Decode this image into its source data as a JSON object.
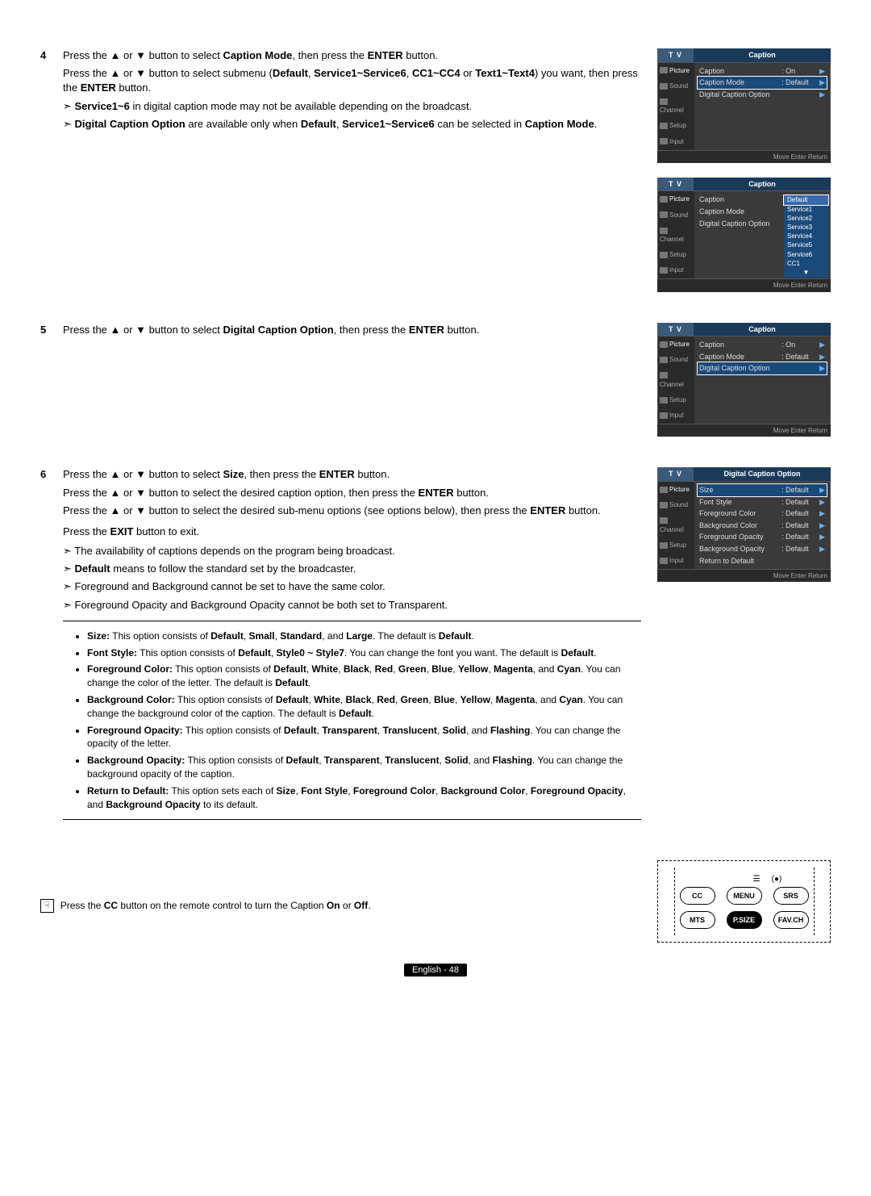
{
  "steps": {
    "s4": {
      "num": "4",
      "p1a": "Press the ▲ or ▼ button to select ",
      "p1b": "Caption Mode",
      "p1c": ", then press the ",
      "p1d": "ENTER",
      "p1e": " button.",
      "p2a": "Press the ▲ or ▼ button to select submenu (",
      "p2b": "Default",
      "p2c": ", ",
      "p2d": "Service1~Service6",
      "p2e": ", ",
      "p2f": "CC1~CC4",
      "p2g": " or ",
      "p2h": "Text1~Text4",
      "p2i": ") you want, then press the ",
      "p2j": "ENTER",
      "p2k": " button.",
      "l1a": "Service1~6",
      "l1b": " in digital caption mode may not be available depending on the broadcast.",
      "l2a": "Digital Caption Option",
      "l2b": " are available only when ",
      "l2c": "Default",
      "l2d": ", ",
      "l2e": "Service1~Service6",
      "l2f": " can be selected in ",
      "l2g": "Caption Mode",
      "l2h": "."
    },
    "s5": {
      "num": "5",
      "p1a": "Press the ▲ or ▼ button to select ",
      "p1b": "Digital Caption Option",
      "p1c": ", then press the ",
      "p1d": "ENTER",
      "p1e": " button."
    },
    "s6": {
      "num": "6",
      "p1a": "Press the ▲ or ▼ button to select ",
      "p1b": "Size",
      "p1c": ", then press the ",
      "p1d": "ENTER",
      "p1e": " button.",
      "p2a": "Press the ▲ or ▼ button to select the desired caption option, then press the ",
      "p2b": "ENTER",
      "p2c": " button.",
      "p3a": "Press the ▲ or ▼ button to select the desired sub-menu options (see options below), then press the ",
      "p3b": "ENTER",
      "p3c": " button.",
      "p4a": "Press the ",
      "p4b": "EXIT",
      "p4c": " button to exit.",
      "l1": "The availability of captions depends on the program being broadcast.",
      "l2a": "Default",
      "l2b": " means to follow the standard set by the broadcaster.",
      "l3": "Foreground and Background cannot be set to have the same color.",
      "l4": "Foreground Opacity and Background Opacity cannot be both set to Transparent."
    }
  },
  "notes": {
    "n1a": "Size:",
    "n1b": " This option consists of ",
    "n1c": "Default",
    "n1d": ", ",
    "n1e": "Small",
    "n1f": ", ",
    "n1g": "Standard",
    "n1h": ", and ",
    "n1i": "Large",
    "n1j": ". The default is ",
    "n1k": "Default",
    "n1l": ".",
    "n2a": "Font Style:",
    "n2b": " This option consists of ",
    "n2c": "Default",
    "n2d": ", ",
    "n2e": "Style0 ~ Style7",
    "n2f": ". You can change the font you want. The default is ",
    "n2g": "Default",
    "n2h": ".",
    "n3a": "Foreground Color:",
    "n3b": " This option consists of ",
    "n3c": "Default",
    "n3d": ", ",
    "n3e": "White",
    "n3f": ", ",
    "n3g": "Black",
    "n3h": ", ",
    "n3i": "Red",
    "n3j": ", ",
    "n3k": "Green",
    "n3l": ", ",
    "n3m": "Blue",
    "n3n": ", ",
    "n3o": "Yellow",
    "n3p": ", ",
    "n3q": "Magenta",
    "n3r": ", and ",
    "n3s": "Cyan",
    "n3t": ". You can change the color of the letter. The default is ",
    "n3u": "Default",
    "n3v": ".",
    "n4a": "Background Color:",
    "n4b": " This option consists of ",
    "n4c": "Default",
    "n4d": ", ",
    "n4e": "White",
    "n4f": ", ",
    "n4g": "Black",
    "n4h": ", ",
    "n4i": "Red",
    "n4j": ", ",
    "n4k": "Green",
    "n4l": ", ",
    "n4m": "Blue",
    "n4n": ", ",
    "n4o": "Yellow",
    "n4p": ", ",
    "n4q": "Magenta",
    "n4r": ", and ",
    "n4s": "Cyan",
    "n4t": ". You can change the background color of the caption. The default is ",
    "n4u": "Default",
    "n4v": ".",
    "n5a": "Foreground Opacity:",
    "n5b": " This option consists of ",
    "n5c": "Default",
    "n5d": ", ",
    "n5e": "Transparent",
    "n5f": ", ",
    "n5g": "Translucent",
    "n5h": ", ",
    "n5i": "Solid",
    "n5j": ", and ",
    "n5k": "Flashing",
    "n5l": ". You can change the opacity of the letter.",
    "n6a": "Background Opacity:",
    "n6b": " This option consists of ",
    "n6c": "Default",
    "n6d": ", ",
    "n6e": "Transparent",
    "n6f": ", ",
    "n6g": "Translucent",
    "n6h": ", ",
    "n6i": "Solid",
    "n6j": ", and ",
    "n6k": "Flashing",
    "n6l": ". You can change the background opacity of the caption.",
    "n7a": "Return to Default:",
    "n7b": " This option sets each of ",
    "n7c": "Size",
    "n7d": ", ",
    "n7e": "Font Style",
    "n7f": ", ",
    "n7g": "Foreground Color",
    "n7h": ", ",
    "n7i": "Background Color",
    "n7j": ", ",
    "n7k": "Foreground Opacity",
    "n7l": ", and ",
    "n7m": "Background Opacity",
    "n7n": " to its default."
  },
  "tip": {
    "a": "Press the ",
    "b": "CC",
    "c": " button on the remote control to turn the Caption ",
    "d": "On",
    "e": " or ",
    "f": "Off",
    "g": "."
  },
  "footer": "English - 48",
  "tv": {
    "tab": "T V",
    "sidebar": [
      "Picture",
      "Sound",
      "Channel",
      "Setup",
      "Input"
    ],
    "footer": "Move          Enter        Return",
    "arrow": "▶",
    "box1": {
      "title": "Caption",
      "rows": [
        {
          "l": "Caption",
          "v": ": On"
        },
        {
          "l": "Caption Mode",
          "v": ": Default",
          "sel": true
        },
        {
          "l": "Digital Caption Option",
          "v": ""
        }
      ]
    },
    "box2": {
      "title": "Caption",
      "rows": [
        {
          "l": "Caption",
          "v": ":"
        },
        {
          "l": "Caption Mode",
          "v": ""
        },
        {
          "l": "Digital Caption Option",
          "v": ""
        }
      ],
      "dropdown": [
        "Default",
        "Service1",
        "Service2",
        "Service3",
        "Service4",
        "Service5",
        "Service6",
        "CC1",
        "▼"
      ]
    },
    "box3": {
      "title": "Caption",
      "rows": [
        {
          "l": "Caption",
          "v": ": On"
        },
        {
          "l": "Caption Mode",
          "v": ": Default"
        },
        {
          "l": "Digital Caption Option",
          "v": "",
          "sel": true
        }
      ]
    },
    "box4": {
      "title": "Digital Caption Option",
      "rows": [
        {
          "l": "Size",
          "v": ": Default",
          "sel": true
        },
        {
          "l": "Font Style",
          "v": ": Default"
        },
        {
          "l": "Foreground Color",
          "v": ": Default"
        },
        {
          "l": "Background Color",
          "v": ": Default"
        },
        {
          "l": "Foreground Opacity",
          "v": ": Default"
        },
        {
          "l": "Background Opacity",
          "v": ": Default"
        },
        {
          "l": "Return to Default",
          "v": ""
        }
      ]
    }
  },
  "remote": {
    "r1": [
      "CC",
      "MENU",
      "SRS"
    ],
    "r2": [
      "MTS",
      "P.SIZE",
      "FAV.CH"
    ],
    "top": [
      "☰",
      "(●)"
    ]
  }
}
